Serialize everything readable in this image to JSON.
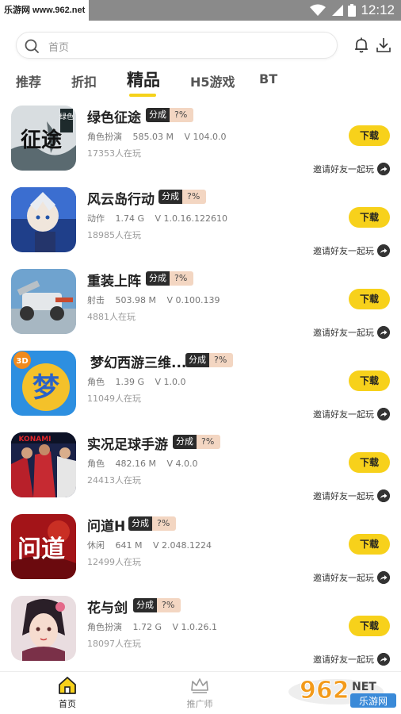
{
  "statusbar": {
    "watermark": "乐游网 www.962.net",
    "time": "12:12"
  },
  "search": {
    "placeholder": "首页"
  },
  "tabs": [
    {
      "label": "推荐"
    },
    {
      "label": "折扣"
    },
    {
      "label": "精品"
    },
    {
      "label": "H5游戏"
    },
    {
      "label": "BT"
    }
  ],
  "apps": [
    {
      "name": "绿色征途",
      "badge_a": "分成",
      "badge_b": "?%",
      "category": "角色扮演",
      "size": "585.03 M",
      "version": "V 104.0.0",
      "players": "17353人在玩",
      "download": "下载",
      "invite": "邀请好友一起玩"
    },
    {
      "name": "风云岛行动",
      "badge_a": "分成",
      "badge_b": "?%",
      "category": "动作",
      "size": "1.74 G",
      "version": "V 1.0.16.122610",
      "players": "18985人在玩",
      "download": "下载",
      "invite": "邀请好友一起玩"
    },
    {
      "name": "重装上阵",
      "badge_a": "分成",
      "badge_b": "?%",
      "category": "射击",
      "size": "503.98 M",
      "version": "V 0.100.139",
      "players": "4881人在玩",
      "download": "下载",
      "invite": "邀请好友一起玩"
    },
    {
      "name": "梦幻西游三维...",
      "badge_a": "分成",
      "badge_b": "?%",
      "category": "角色",
      "size": "1.39 G",
      "version": "V 1.0.0",
      "players": "11049人在玩",
      "download": "下载",
      "invite": "邀请好友一起玩"
    },
    {
      "name": "实况足球手游",
      "badge_a": "分成",
      "badge_b": "?%",
      "category": "角色",
      "size": "482.16 M",
      "version": "V 4.0.0",
      "players": "24413人在玩",
      "download": "下载",
      "invite": "邀请好友一起玩"
    },
    {
      "name": "问道H",
      "badge_a": "分成",
      "badge_b": "?%",
      "category": "休闲",
      "size": "641 M",
      "version": "V 2.048.1224",
      "players": "12499人在玩",
      "download": "下载",
      "invite": "邀请好友一起玩"
    },
    {
      "name": "花与剑",
      "badge_a": "分成",
      "badge_b": "?%",
      "category": "角色扮演",
      "size": "1.72 G",
      "version": "V 1.0.26.1",
      "players": "18097人在玩",
      "download": "下载",
      "invite": "邀请好友一起玩"
    }
  ],
  "icon_art": {
    "icon_1": {
      "big": "征途",
      "small": "绿色"
    },
    "icon_4": {
      "corner": "3D",
      "big": "梦"
    },
    "icon_5": {
      "brand": "KONAMI"
    },
    "icon_6": {
      "big": "问道"
    }
  },
  "bottom_nav": [
    {
      "label": "首页",
      "icon": "home-icon",
      "active": true
    },
    {
      "label": "推广师",
      "icon": "crown-icon",
      "active": false
    }
  ],
  "overlay_logo": {
    "big": "962",
    "small": "NET",
    "text": "乐游网"
  },
  "colors": {
    "accent": "#f7d11b",
    "badge_dark": "#2b2b2b",
    "badge_light": "#f3d6c2"
  }
}
